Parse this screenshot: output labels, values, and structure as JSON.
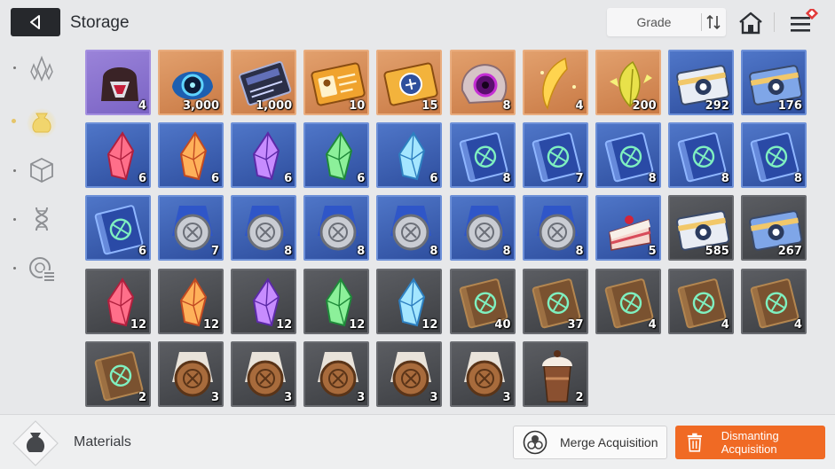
{
  "header": {
    "title": "Storage",
    "sort_label": "Grade",
    "back_icon": "back-arrow-icon",
    "sort_icon": "sort-order-icon",
    "home_icon": "home-icon",
    "menu_icon": "menu-icon"
  },
  "sidebar": {
    "tabs": [
      {
        "name": "sidebar-tab-crystals",
        "icon": "crystals-icon",
        "selected": false
      },
      {
        "name": "sidebar-tab-materials",
        "icon": "pouch-icon",
        "selected": true
      },
      {
        "name": "sidebar-tab-packages",
        "icon": "cube-icon",
        "selected": false
      },
      {
        "name": "sidebar-tab-genes",
        "icon": "dna-icon",
        "selected": false
      },
      {
        "name": "sidebar-tab-data",
        "icon": "disc-list-icon",
        "selected": false
      }
    ]
  },
  "items": [
    {
      "icon": "dark-core-icon",
      "qty": "4",
      "grade": "purple"
    },
    {
      "icon": "blue-eye-icon",
      "qty": "3,000",
      "grade": "orange"
    },
    {
      "icon": "data-chip-icon",
      "qty": "1,000",
      "grade": "orange"
    },
    {
      "icon": "id-card-ticket-icon",
      "qty": "10",
      "grade": "orange"
    },
    {
      "icon": "gold-ticket-icon",
      "qty": "15",
      "grade": "orange"
    },
    {
      "icon": "purple-eye-ore-icon",
      "qty": "8",
      "grade": "orange"
    },
    {
      "icon": "gold-feather-icon",
      "qty": "4",
      "grade": "orange"
    },
    {
      "icon": "gold-leaf-icon",
      "qty": "200",
      "grade": "orange"
    },
    {
      "icon": "silver-card-icon",
      "qty": "292",
      "grade": "blue"
    },
    {
      "icon": "blue-card-icon",
      "qty": "176",
      "grade": "blue"
    },
    {
      "icon": "red-crystal-icon",
      "qty": "6",
      "grade": "blue"
    },
    {
      "icon": "orange-crystal-icon",
      "qty": "6",
      "grade": "blue"
    },
    {
      "icon": "purple-crystal-icon",
      "qty": "6",
      "grade": "blue"
    },
    {
      "icon": "green-crystal-icon",
      "qty": "6",
      "grade": "blue"
    },
    {
      "icon": "cyan-crystal-icon",
      "qty": "6",
      "grade": "blue"
    },
    {
      "icon": "sword-manual-icon",
      "qty": "8",
      "grade": "blue"
    },
    {
      "icon": "shield-manual-icon",
      "qty": "7",
      "grade": "blue"
    },
    {
      "icon": "target-manual-icon",
      "qty": "8",
      "grade": "blue"
    },
    {
      "icon": "wing-manual-icon",
      "qty": "8",
      "grade": "blue"
    },
    {
      "icon": "slash-manual-icon",
      "qty": "8",
      "grade": "blue"
    },
    {
      "icon": "globe-manual-icon",
      "qty": "6",
      "grade": "blue"
    },
    {
      "icon": "silver-medal-icon",
      "qty": "7",
      "grade": "blue"
    },
    {
      "icon": "silver-medal-icon",
      "qty": "8",
      "grade": "blue"
    },
    {
      "icon": "silver-medal-icon",
      "qty": "8",
      "grade": "blue"
    },
    {
      "icon": "silver-medal-icon",
      "qty": "8",
      "grade": "blue"
    },
    {
      "icon": "silver-medal-icon",
      "qty": "8",
      "grade": "blue"
    },
    {
      "icon": "silver-medal-icon",
      "qty": "8",
      "grade": "blue"
    },
    {
      "icon": "cake-slice-icon",
      "qty": "5",
      "grade": "blue"
    },
    {
      "icon": "silver-card-icon",
      "qty": "585",
      "grade": "gray"
    },
    {
      "icon": "blue-card-icon",
      "qty": "267",
      "grade": "gray"
    },
    {
      "icon": "red-crystal-icon",
      "qty": "12",
      "grade": "gray"
    },
    {
      "icon": "orange-crystal-icon",
      "qty": "12",
      "grade": "gray"
    },
    {
      "icon": "purple-crystal-icon",
      "qty": "12",
      "grade": "gray"
    },
    {
      "icon": "green-crystal-icon",
      "qty": "12",
      "grade": "gray"
    },
    {
      "icon": "cyan-crystal-icon",
      "qty": "12",
      "grade": "gray"
    },
    {
      "icon": "sword-book-icon",
      "qty": "40",
      "grade": "gray"
    },
    {
      "icon": "shield-book-icon",
      "qty": "37",
      "grade": "gray"
    },
    {
      "icon": "target-book-icon",
      "qty": "4",
      "grade": "gray"
    },
    {
      "icon": "wing-book-icon",
      "qty": "4",
      "grade": "gray"
    },
    {
      "icon": "slash-book-icon",
      "qty": "4",
      "grade": "gray"
    },
    {
      "icon": "globe-book-icon",
      "qty": "2",
      "grade": "gray"
    },
    {
      "icon": "bronze-medal-icon",
      "qty": "3",
      "grade": "gray"
    },
    {
      "icon": "bronze-medal-icon",
      "qty": "3",
      "grade": "gray"
    },
    {
      "icon": "bronze-medal-icon",
      "qty": "3",
      "grade": "gray"
    },
    {
      "icon": "bronze-medal-icon",
      "qty": "3",
      "grade": "gray"
    },
    {
      "icon": "bronze-medal-icon",
      "qty": "3",
      "grade": "gray"
    },
    {
      "icon": "iced-coffee-icon",
      "qty": "2",
      "grade": "gray"
    }
  ],
  "footer": {
    "category_label": "Materials",
    "category_icon": "pouch-icon",
    "merge_label": "Merge Acquisition",
    "merge_icon": "merge-circles-icon",
    "dismantle_label": "Dismanting Acquisition",
    "dismantle_icon": "trash-icon"
  },
  "colors": {
    "accent": "#f06a24",
    "grade_purple": "#8a72d0",
    "grade_orange": "#d88c58",
    "grade_blue": "#3d60b4",
    "grade_gray": "#4c4e52"
  }
}
